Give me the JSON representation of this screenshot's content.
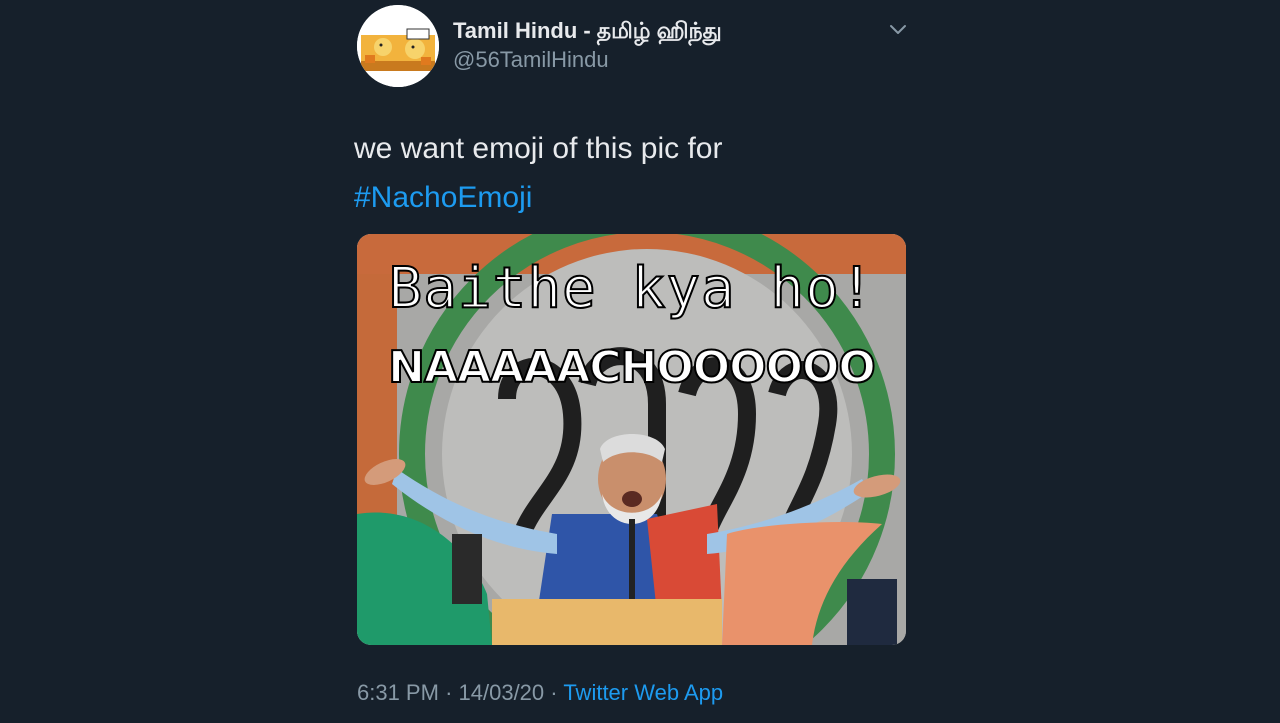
{
  "author": {
    "name": "Tamil Hindu - தமிழ் ஹிந்து",
    "handle": "@56TamilHindu"
  },
  "tweet": {
    "text": "we want emoji of this pic for",
    "hashtag": "#NachoEmoji"
  },
  "media": {
    "caption_line1": "Baithe kya ho!",
    "caption_line2": "NAAAAACHOOOOOO"
  },
  "meta": {
    "time": "6:31 PM",
    "date": "14/03/20",
    "separator": "·",
    "source": "Twitter Web App"
  },
  "colors": {
    "background": "#16202b",
    "link": "#1d9bf0",
    "secondary_text": "#8899a6"
  }
}
